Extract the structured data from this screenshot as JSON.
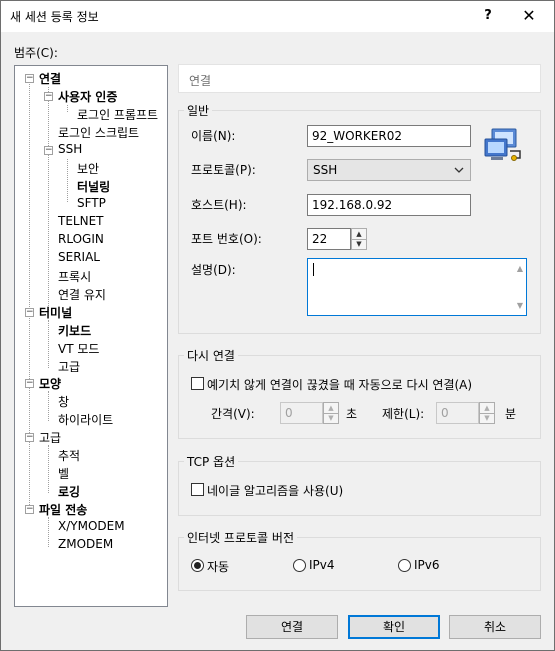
{
  "window": {
    "title": "새 세션 등록 정보",
    "help": "?",
    "close": "✕"
  },
  "category_label": "범주(C):",
  "tree": [
    {
      "label": "연결",
      "bold": true
    },
    {
      "label": "사용자 인증",
      "bold": true
    },
    {
      "label": "로그인 프롬프트",
      "bold": false
    },
    {
      "label": "로그인 스크립트",
      "bold": false
    },
    {
      "label": "SSH",
      "bold": false
    },
    {
      "label": "보안",
      "bold": false
    },
    {
      "label": "터널링",
      "bold": true
    },
    {
      "label": "SFTP",
      "bold": false
    },
    {
      "label": "TELNET",
      "bold": false
    },
    {
      "label": "RLOGIN",
      "bold": false
    },
    {
      "label": "SERIAL",
      "bold": false
    },
    {
      "label": "프록시",
      "bold": false
    },
    {
      "label": "연결 유지",
      "bold": false
    },
    {
      "label": "터미널",
      "bold": true
    },
    {
      "label": "키보드",
      "bold": true
    },
    {
      "label": "VT 모드",
      "bold": false
    },
    {
      "label": "고급",
      "bold": false
    },
    {
      "label": "모양",
      "bold": true
    },
    {
      "label": "창",
      "bold": false
    },
    {
      "label": "하이라이트",
      "bold": false
    },
    {
      "label": "고급",
      "bold": false
    },
    {
      "label": "추적",
      "bold": false
    },
    {
      "label": "벨",
      "bold": false
    },
    {
      "label": "로깅",
      "bold": true
    },
    {
      "label": "파일 전송",
      "bold": true
    },
    {
      "label": "X/YMODEM",
      "bold": false
    },
    {
      "label": "ZMODEM",
      "bold": false
    }
  ],
  "pane_title": "연결",
  "general": {
    "legend": "일반",
    "name_label": "이름(N):",
    "name_value": "92_WORKER02",
    "protocol_label": "프로토콜(P):",
    "protocol_value": "SSH",
    "host_label": "호스트(H):",
    "host_value": "192.168.0.92",
    "port_label": "포트 번호(O):",
    "port_value": "22",
    "desc_label": "설명(D):",
    "desc_value": ""
  },
  "reconnect": {
    "legend": "다시 연결",
    "auto_label": "예기치 않게 연결이 끊겼을 때 자동으로 다시 연결(A)",
    "interval_label": "간격(V):",
    "interval_value": "0",
    "interval_unit": "초",
    "limit_label": "제한(L):",
    "limit_value": "0",
    "limit_unit": "분"
  },
  "tcp": {
    "legend": "TCP 옵션",
    "nagle_label": "네이글 알고리즘을 사용(U)"
  },
  "ipver": {
    "legend": "인터넷 프로토콜 버전",
    "options": [
      "자동",
      "IPv4",
      "IPv6"
    ],
    "selected": "자동"
  },
  "buttons": {
    "connect": "연결",
    "ok": "확인",
    "cancel": "취소"
  }
}
